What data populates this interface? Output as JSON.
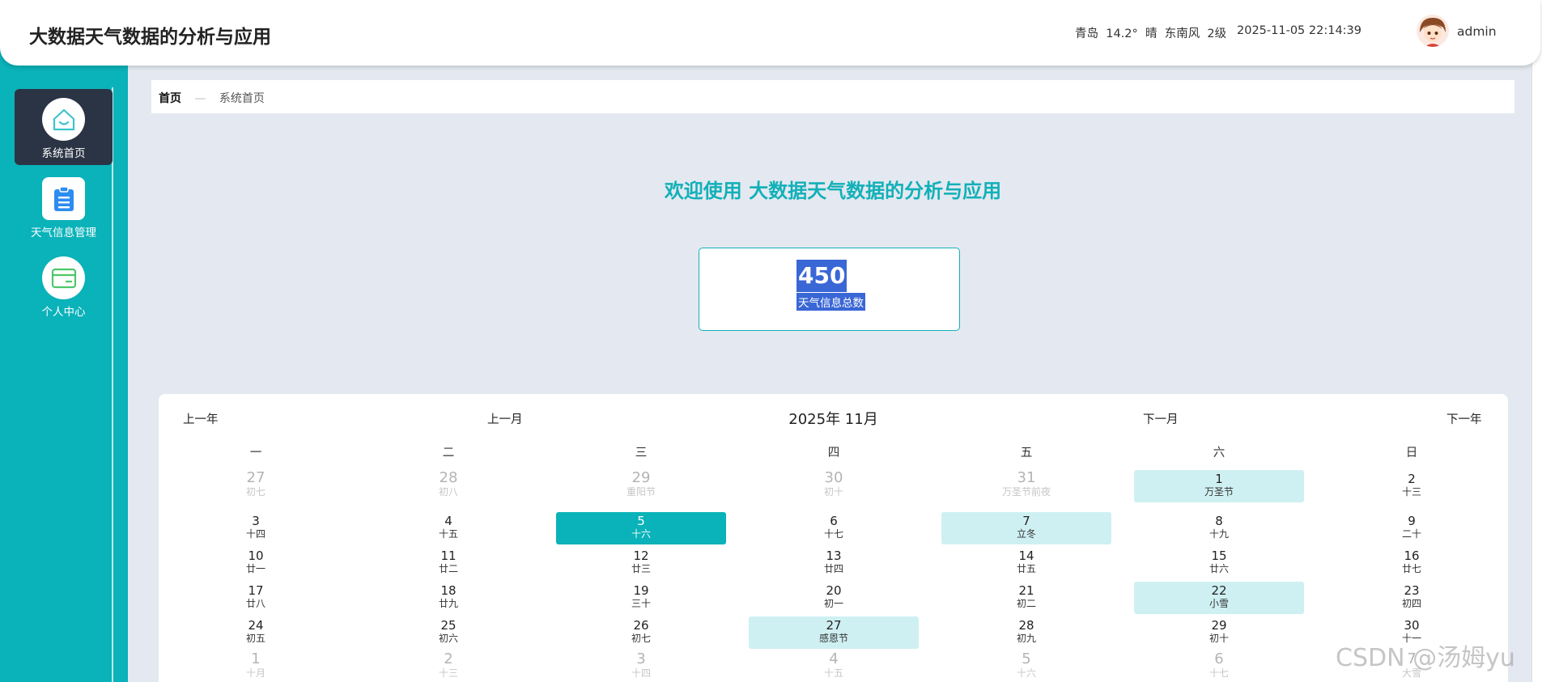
{
  "header": {
    "title": "大数据天气数据的分析与应用",
    "weather": "青岛  14.2°  晴  东南风  2级",
    "datetime": "2025-11-05 22:14:39",
    "username": "admin"
  },
  "sidebar": {
    "items": [
      {
        "label": "系统首页",
        "icon": "home-icon",
        "active": true
      },
      {
        "label": "天气信息管理",
        "icon": "clipboard-icon",
        "active": false
      },
      {
        "label": "个人中心",
        "icon": "card-icon",
        "active": false
      }
    ]
  },
  "breadcrumb": {
    "home": "首页",
    "separator": "—",
    "current": "系统首页"
  },
  "main": {
    "welcome": "欢迎使用 大数据天气数据的分析与应用",
    "stat": {
      "value": "450",
      "label": "天气信息总数"
    }
  },
  "calendar": {
    "prev_year": "上一年",
    "prev_month": "上一月",
    "title": "2025年 11月",
    "next_month": "下一月",
    "next_year": "下一年",
    "weekdays": [
      "一",
      "二",
      "三",
      "四",
      "五",
      "六",
      "日"
    ],
    "days": [
      {
        "num": "27",
        "lunar": "初七",
        "other": true
      },
      {
        "num": "28",
        "lunar": "初八",
        "other": true
      },
      {
        "num": "29",
        "lunar": "重阳节",
        "other": true
      },
      {
        "num": "30",
        "lunar": "初十",
        "other": true
      },
      {
        "num": "31",
        "lunar": "万圣节前夜",
        "other": true
      },
      {
        "num": "1",
        "lunar": "万圣节",
        "highlight": true
      },
      {
        "num": "2",
        "lunar": "十三"
      },
      {
        "num": "3",
        "lunar": "十四"
      },
      {
        "num": "4",
        "lunar": "十五"
      },
      {
        "num": "5",
        "lunar": "十六",
        "today": true
      },
      {
        "num": "6",
        "lunar": "十七"
      },
      {
        "num": "7",
        "lunar": "立冬",
        "highlight": true
      },
      {
        "num": "8",
        "lunar": "十九"
      },
      {
        "num": "9",
        "lunar": "二十"
      },
      {
        "num": "10",
        "lunar": "廿一"
      },
      {
        "num": "11",
        "lunar": "廿二"
      },
      {
        "num": "12",
        "lunar": "廿三"
      },
      {
        "num": "13",
        "lunar": "廿四"
      },
      {
        "num": "14",
        "lunar": "廿五"
      },
      {
        "num": "15",
        "lunar": "廿六"
      },
      {
        "num": "16",
        "lunar": "廿七"
      },
      {
        "num": "17",
        "lunar": "廿八"
      },
      {
        "num": "18",
        "lunar": "廿九"
      },
      {
        "num": "19",
        "lunar": "三十"
      },
      {
        "num": "20",
        "lunar": "初一"
      },
      {
        "num": "21",
        "lunar": "初二"
      },
      {
        "num": "22",
        "lunar": "小雪",
        "highlight": true
      },
      {
        "num": "23",
        "lunar": "初四"
      },
      {
        "num": "24",
        "lunar": "初五"
      },
      {
        "num": "25",
        "lunar": "初六"
      },
      {
        "num": "26",
        "lunar": "初七"
      },
      {
        "num": "27",
        "lunar": "感恩节",
        "highlight": true
      },
      {
        "num": "28",
        "lunar": "初九"
      },
      {
        "num": "29",
        "lunar": "初十"
      },
      {
        "num": "30",
        "lunar": "十一"
      },
      {
        "num": "1",
        "lunar": "十月",
        "other": true
      },
      {
        "num": "2",
        "lunar": "十三",
        "other": true
      },
      {
        "num": "3",
        "lunar": "十四",
        "other": true
      },
      {
        "num": "4",
        "lunar": "十五",
        "other": true
      },
      {
        "num": "5",
        "lunar": "十六",
        "other": true
      },
      {
        "num": "6",
        "lunar": "十七",
        "other": true
      },
      {
        "num": "7",
        "lunar": "大雪",
        "other": true
      }
    ]
  },
  "watermark": "CSDN @汤姆yu",
  "colors": {
    "accent": "#0ab2b9",
    "highlight": "#cff0f2",
    "active_nav": "#2b3444",
    "selection": "#3a67d6"
  }
}
